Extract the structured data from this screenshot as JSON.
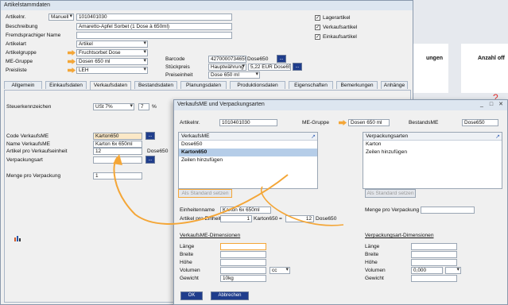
{
  "main": {
    "title": "Artikelstammdaten",
    "artikelnr_label": "Artikelnr.",
    "artikelnr_mode": "Manuell",
    "artikelnr": "1010401030",
    "beschreibung_label": "Beschreibung",
    "beschreibung": "Amaretto-Apfel Sorbet (1 Dose à 650ml)",
    "fremd_label": "Fremdsprachiger Name",
    "artikelart_label": "Artikelart",
    "artikelart": "Artikel",
    "artikelgruppe_label": "Artikelgruppe",
    "artikelgruppe": "Fruchtsorbet Dose",
    "megruppe_label": "ME-Gruppe",
    "megruppe": "Dosen 650 ml",
    "preisliste_label": "Preisliste",
    "preisliste": "LEH",
    "lager_label": "Lagerartikel",
    "verkauf_label": "Verkaufsartikel",
    "einkauf_label": "Einkaufsartikel",
    "barcode_label": "Barcode",
    "barcode": "4270000734659",
    "barcode_suffix": "Dose650",
    "stueckpreis_label": "Stückpreis",
    "waehrung": "Hauptwährung",
    "preis": "5,22 EUR Dose650",
    "preiseinheit_label": "Preiseinheit",
    "preiseinheit": "Dose 650 ml",
    "tabs": [
      "Allgemein",
      "Einkaufsdaten",
      "Verkaufsdaten",
      "Bestandsdaten",
      "Planungsdaten",
      "Produktionsdaten",
      "Eigenschaften",
      "Bemerkungen",
      "Anhänge"
    ],
    "steuer_label": "Steuerkennzeichen",
    "steuer": "USt 7%",
    "steuer_pct": "7",
    "pct": "%",
    "codeme_label": "Code VerkaufsME",
    "codeme": "Karton650",
    "nameme_label": "Name VerkaufsME",
    "nameme": "Karton 6x 650ml",
    "proeinheit_label": "Artikel pro Verkaufseinheit",
    "proeinheit": "12",
    "proeinheit_unit": "Dose650",
    "vpart_label": "Verpackungsart",
    "menge_label": "Menge pro Verpackung",
    "menge": "1"
  },
  "bg": {
    "rungen": "ungen",
    "anzahl": "Anzahl off"
  },
  "dialog": {
    "title": "VerkaufsME und Verpackungsarten",
    "artikelnr_label": "Artikelnr.",
    "artikelnr": "1010401030",
    "megruppe_label": "ME-Gruppe",
    "megruppe": "Dosen 650 ml",
    "bestand_label": "BestandsME",
    "bestand": "Dose650",
    "vme_header": "VerkaufsME",
    "vme_items": [
      "Dose650",
      "Karton650",
      "Zeilen hinzufügen"
    ],
    "vpa_header": "Verpackungsarten",
    "vpa_items": [
      "Karton",
      "Zeilen hinzufügen"
    ],
    "std_btn": "Als Standard setzen",
    "einheitenname_label": "Einheitenname",
    "einheitenname": "Karton 6x 650ml",
    "menge_vp_label": "Menge pro Verpackung",
    "ape_label": "Artikel pro Einheit",
    "ape_val": "1",
    "ape_unit": "Karton650",
    "eq": "=",
    "ape_val2": "12",
    "ape_unit2": "Dose650",
    "vme_dim": "VerkaufsME-Dimensionen",
    "vpa_dim": "Verpackungsart-Dimensionen",
    "laenge": "Länge",
    "breite": "Breite",
    "hoehe": "Höhe",
    "volumen": "Volumen",
    "gewicht": "Gewicht",
    "vol_unit": "cc",
    "gewicht_val": "10kg",
    "vp_vol": "0,000",
    "ok": "OK",
    "cancel": "Abbrechen"
  }
}
